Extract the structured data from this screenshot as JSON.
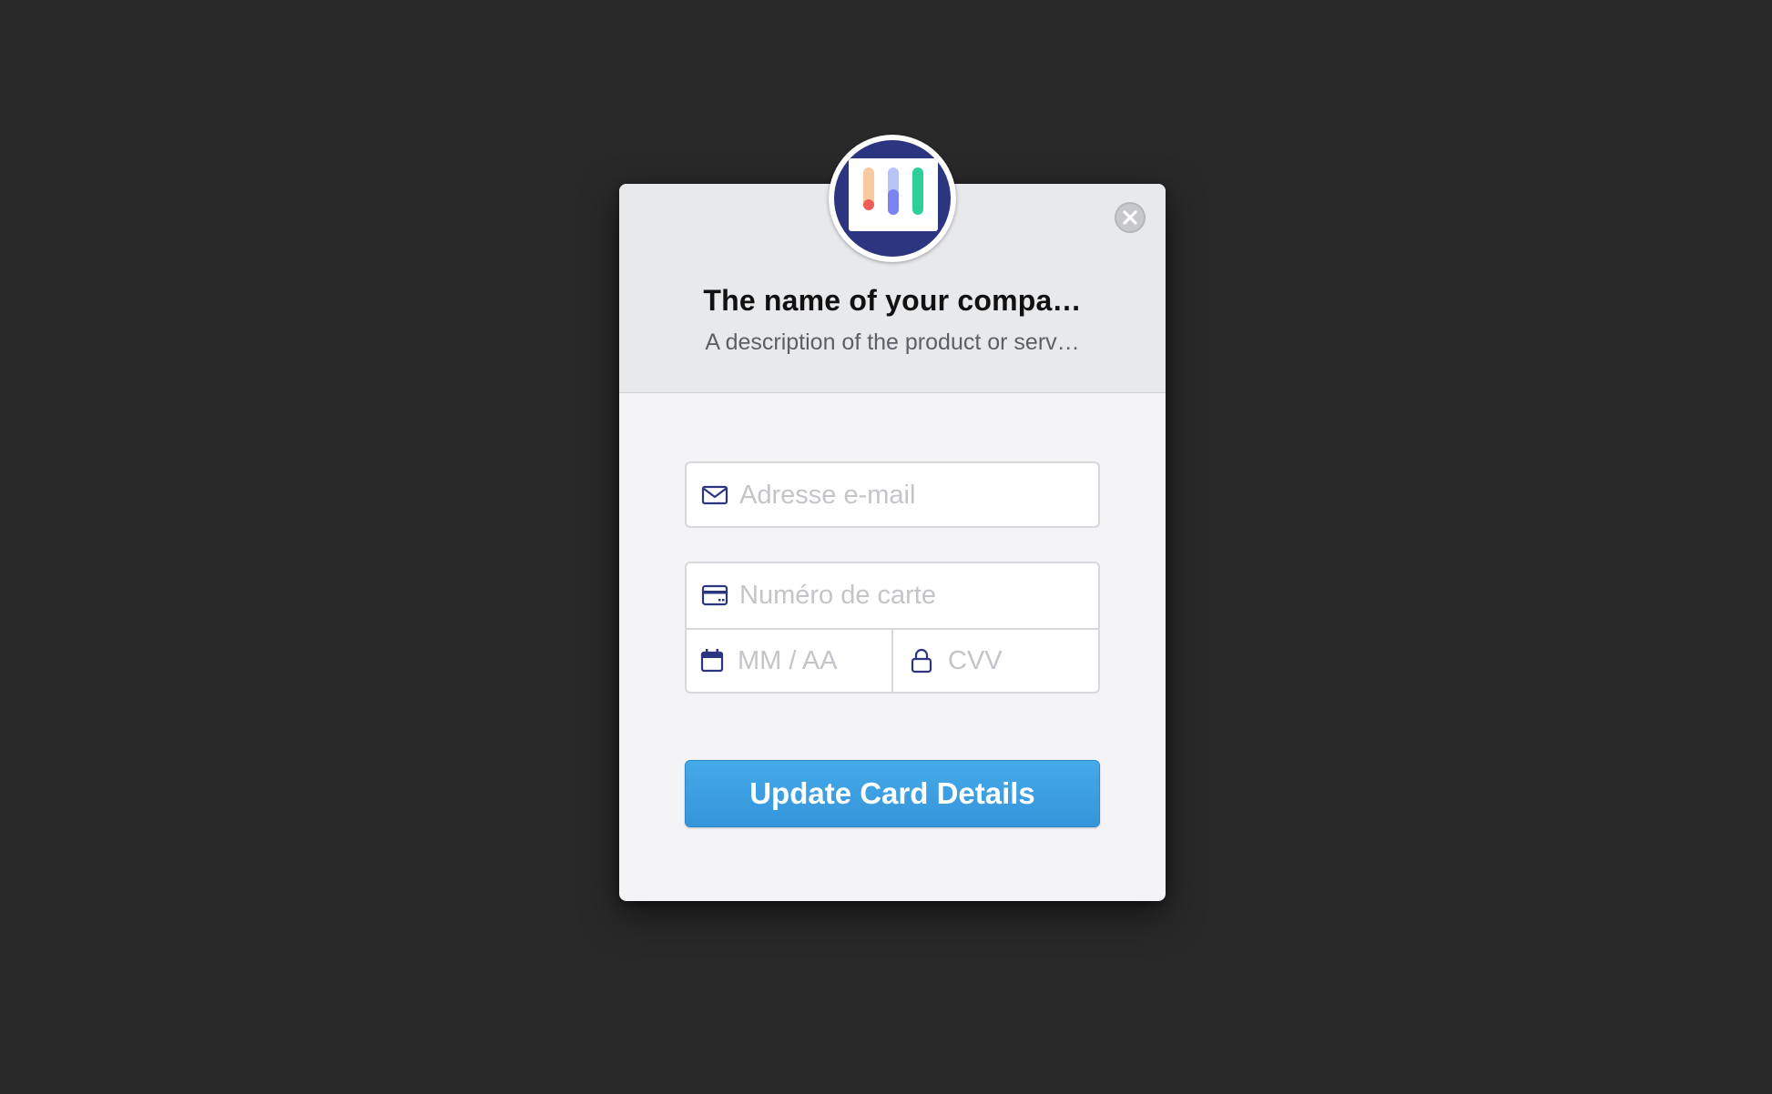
{
  "header": {
    "company_name": "The name of your compa…",
    "description": "A description of the product or serv…"
  },
  "logo": {
    "icon": "bar-chart-logo",
    "bar_colors": [
      "#f7c9a0",
      "#b8c4f6",
      "#2fcf9a"
    ],
    "dot_colors": [
      "#ef5b57",
      "#7b83f3",
      "#27c793"
    ]
  },
  "close": {
    "icon": "close-icon"
  },
  "form": {
    "email": {
      "placeholder": "Adresse e-mail",
      "value": "",
      "icon": "envelope-icon"
    },
    "card_number": {
      "placeholder": "Numéro de carte",
      "value": "",
      "icon": "credit-card-icon"
    },
    "expiry": {
      "placeholder": "MM / AA",
      "value": "",
      "icon": "calendar-icon"
    },
    "cvv": {
      "placeholder": "CVV",
      "value": "",
      "icon": "lock-icon"
    },
    "submit_label": "Update Card Details"
  },
  "colors": {
    "accent": "#3a9de0",
    "icon_navy": "#2b3580",
    "background": "#292929"
  }
}
